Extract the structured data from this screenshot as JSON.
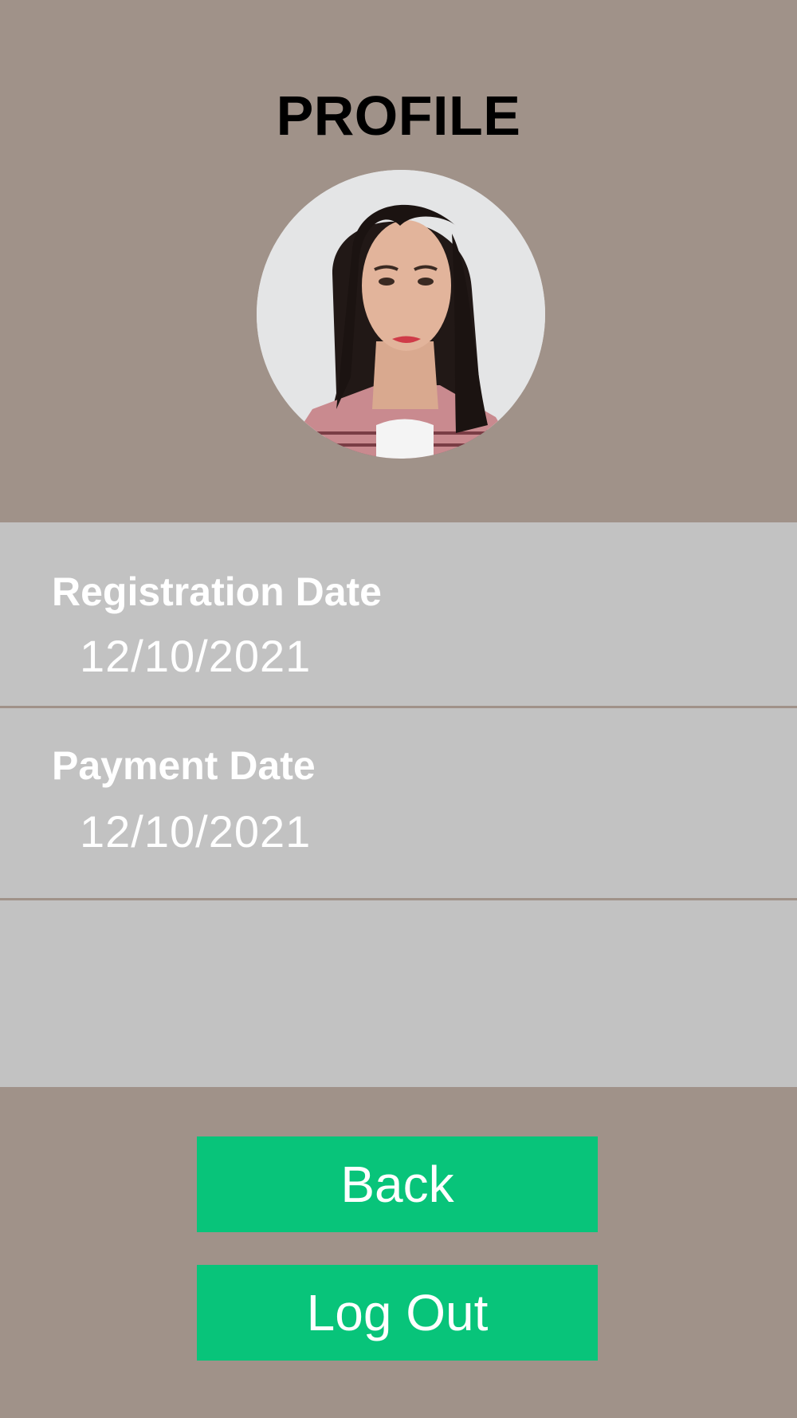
{
  "header": {
    "title": "PROFILE"
  },
  "profile": {
    "avatar": "profile-photo"
  },
  "info": {
    "rows": [
      {
        "label": "Registration Date",
        "value": "12/10/2021"
      },
      {
        "label": "Payment Date",
        "value": "12/10/2021"
      }
    ]
  },
  "actions": {
    "back_label": "Back",
    "logout_label": "Log Out"
  },
  "colors": {
    "background": "#a09289",
    "panel": "#c2c2c2",
    "button": "#08c47a",
    "text_light": "#ffffff",
    "title": "#000000"
  }
}
